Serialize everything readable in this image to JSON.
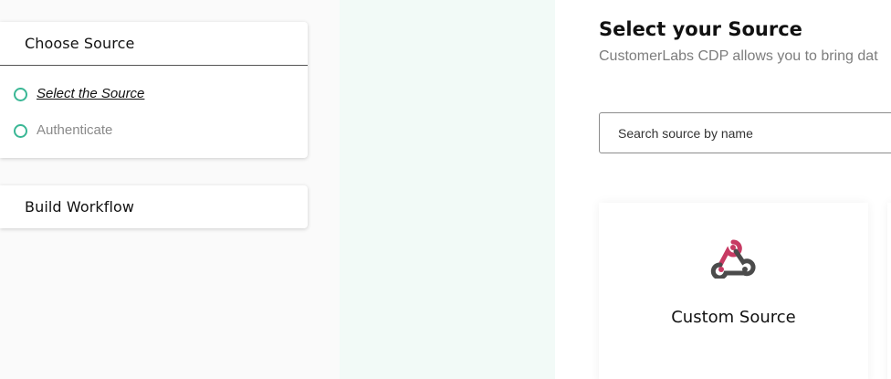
{
  "steps_panel": {
    "choose_source": {
      "title": "Choose Source",
      "steps": [
        {
          "label": "Select the Source",
          "state": "active"
        },
        {
          "label": "Authenticate",
          "state": "inactive"
        }
      ]
    },
    "build_workflow": {
      "title": "Build Workflow"
    }
  },
  "main": {
    "title": "Select your Source",
    "subtitle": "CustomerLabs CDP allows you to bring dat",
    "search": {
      "placeholder": "Search source by name",
      "value": ""
    },
    "sources": [
      {
        "label": "Custom Source",
        "icon": "webhook-icon"
      }
    ]
  },
  "colors": {
    "step_dot": "#3ab795",
    "mint_background": "#f2faf7",
    "webhook_red": "#c73a63",
    "webhook_dark": "#4b4b4b"
  }
}
